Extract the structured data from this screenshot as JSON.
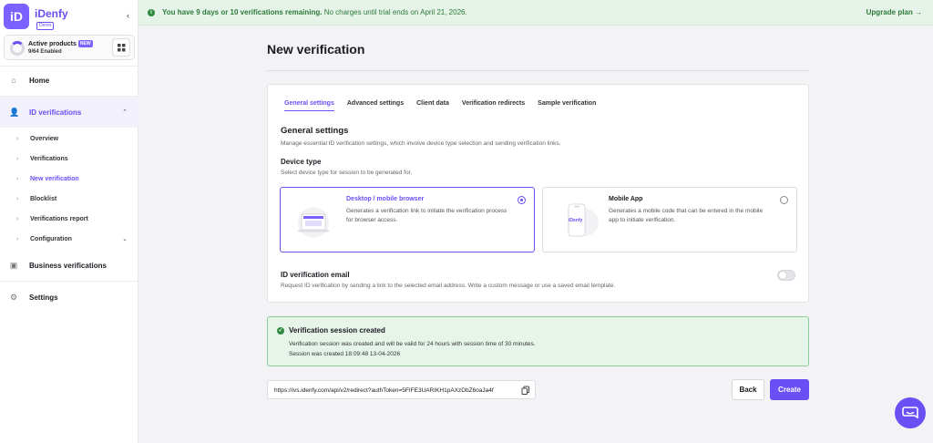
{
  "brand": {
    "name": "iDenfy",
    "badge": "Demo",
    "logo_text": "iD"
  },
  "products": {
    "title": "Active products",
    "badge": "NEW",
    "subtitle": "9/64 Enabled"
  },
  "nav": {
    "home": "Home",
    "id_verifications": "ID verifications",
    "sub": [
      "Overview",
      "Verifications",
      "New verification",
      "Blocklist",
      "Verifications report",
      "Configuration"
    ],
    "business": "Business verifications",
    "settings": "Settings"
  },
  "banner": {
    "bold": "You have 9 days or 10 verifications remaining.",
    "rest": " No charges until trial ends on April 21, 2026.",
    "link": "Upgrade plan"
  },
  "page": {
    "title": "New verification"
  },
  "tabs": [
    "General settings",
    "Advanced settings",
    "Client data",
    "Verification redirects",
    "Sample verification"
  ],
  "general": {
    "title": "General settings",
    "desc": "Manage essential ID verification settings, which involve device type selection and sending verification links.",
    "device_title": "Device type",
    "device_desc": "Select device type for session to be generated for."
  },
  "options": {
    "desktop": {
      "title": "Desktop / mobile browser",
      "desc": "Generates a verification link to initiate the verification process for browser access."
    },
    "mobile": {
      "title": "Mobile App",
      "desc": "Generates a mobile code that can be entered in the mobile app to initiate verification.",
      "art_label": "iDenfy"
    }
  },
  "email": {
    "title": "ID verification email",
    "desc": "Request ID verification by sending a link to the selected email address. Write a custom message or use a saved email template."
  },
  "alert": {
    "title": "Verification session created",
    "line1": "Verification session was created and will be valid for 24 hours with session time of 30 minutes.",
    "line2": "Session was created 18:09:48 13-04-2026"
  },
  "url": "https://ivs.idenfy.com/api/v2/redirect?authToken=5FIFE3UARIKH1pAXzDbZ6oaJa4f",
  "buttons": {
    "back": "Back",
    "create": "Create"
  },
  "colors": {
    "accent": "#6a4ff5",
    "success": "#2f8a3f",
    "banner_bg": "#e6f3e8"
  }
}
